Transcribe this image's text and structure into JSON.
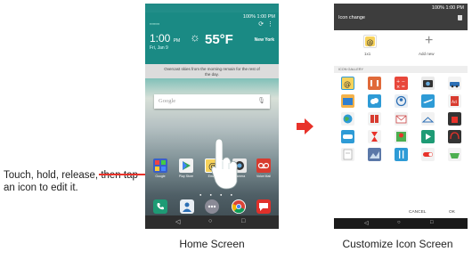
{
  "instruction": "Touch, hold, release, then tap an icon to edit it.",
  "home": {
    "status": "100% 1:00 PM",
    "time": "1:00",
    "time_ampm": "PM",
    "date": "Fri, Jan 9",
    "temperature": "55°F",
    "city": "New York",
    "forecast": "Overcast skies from the morning remain for the rest of the day.",
    "search_word": "Google",
    "apps": [
      "Google",
      "Play Store",
      "Email",
      "Camera",
      "Voice Mail"
    ],
    "caption": "Home Screen"
  },
  "customize": {
    "status": "100% 1:00 PM",
    "title": "Icon change",
    "current_label": "1x1",
    "add_label": "Add new",
    "gallery_heading": "ICON GALLERY",
    "cancel_label": "CANCEL",
    "ok_label": "OK",
    "caption": "Customize Icon Screen"
  },
  "colors": {
    "accent_red": "#e8322a",
    "weather_teal": "#1a8a84"
  }
}
